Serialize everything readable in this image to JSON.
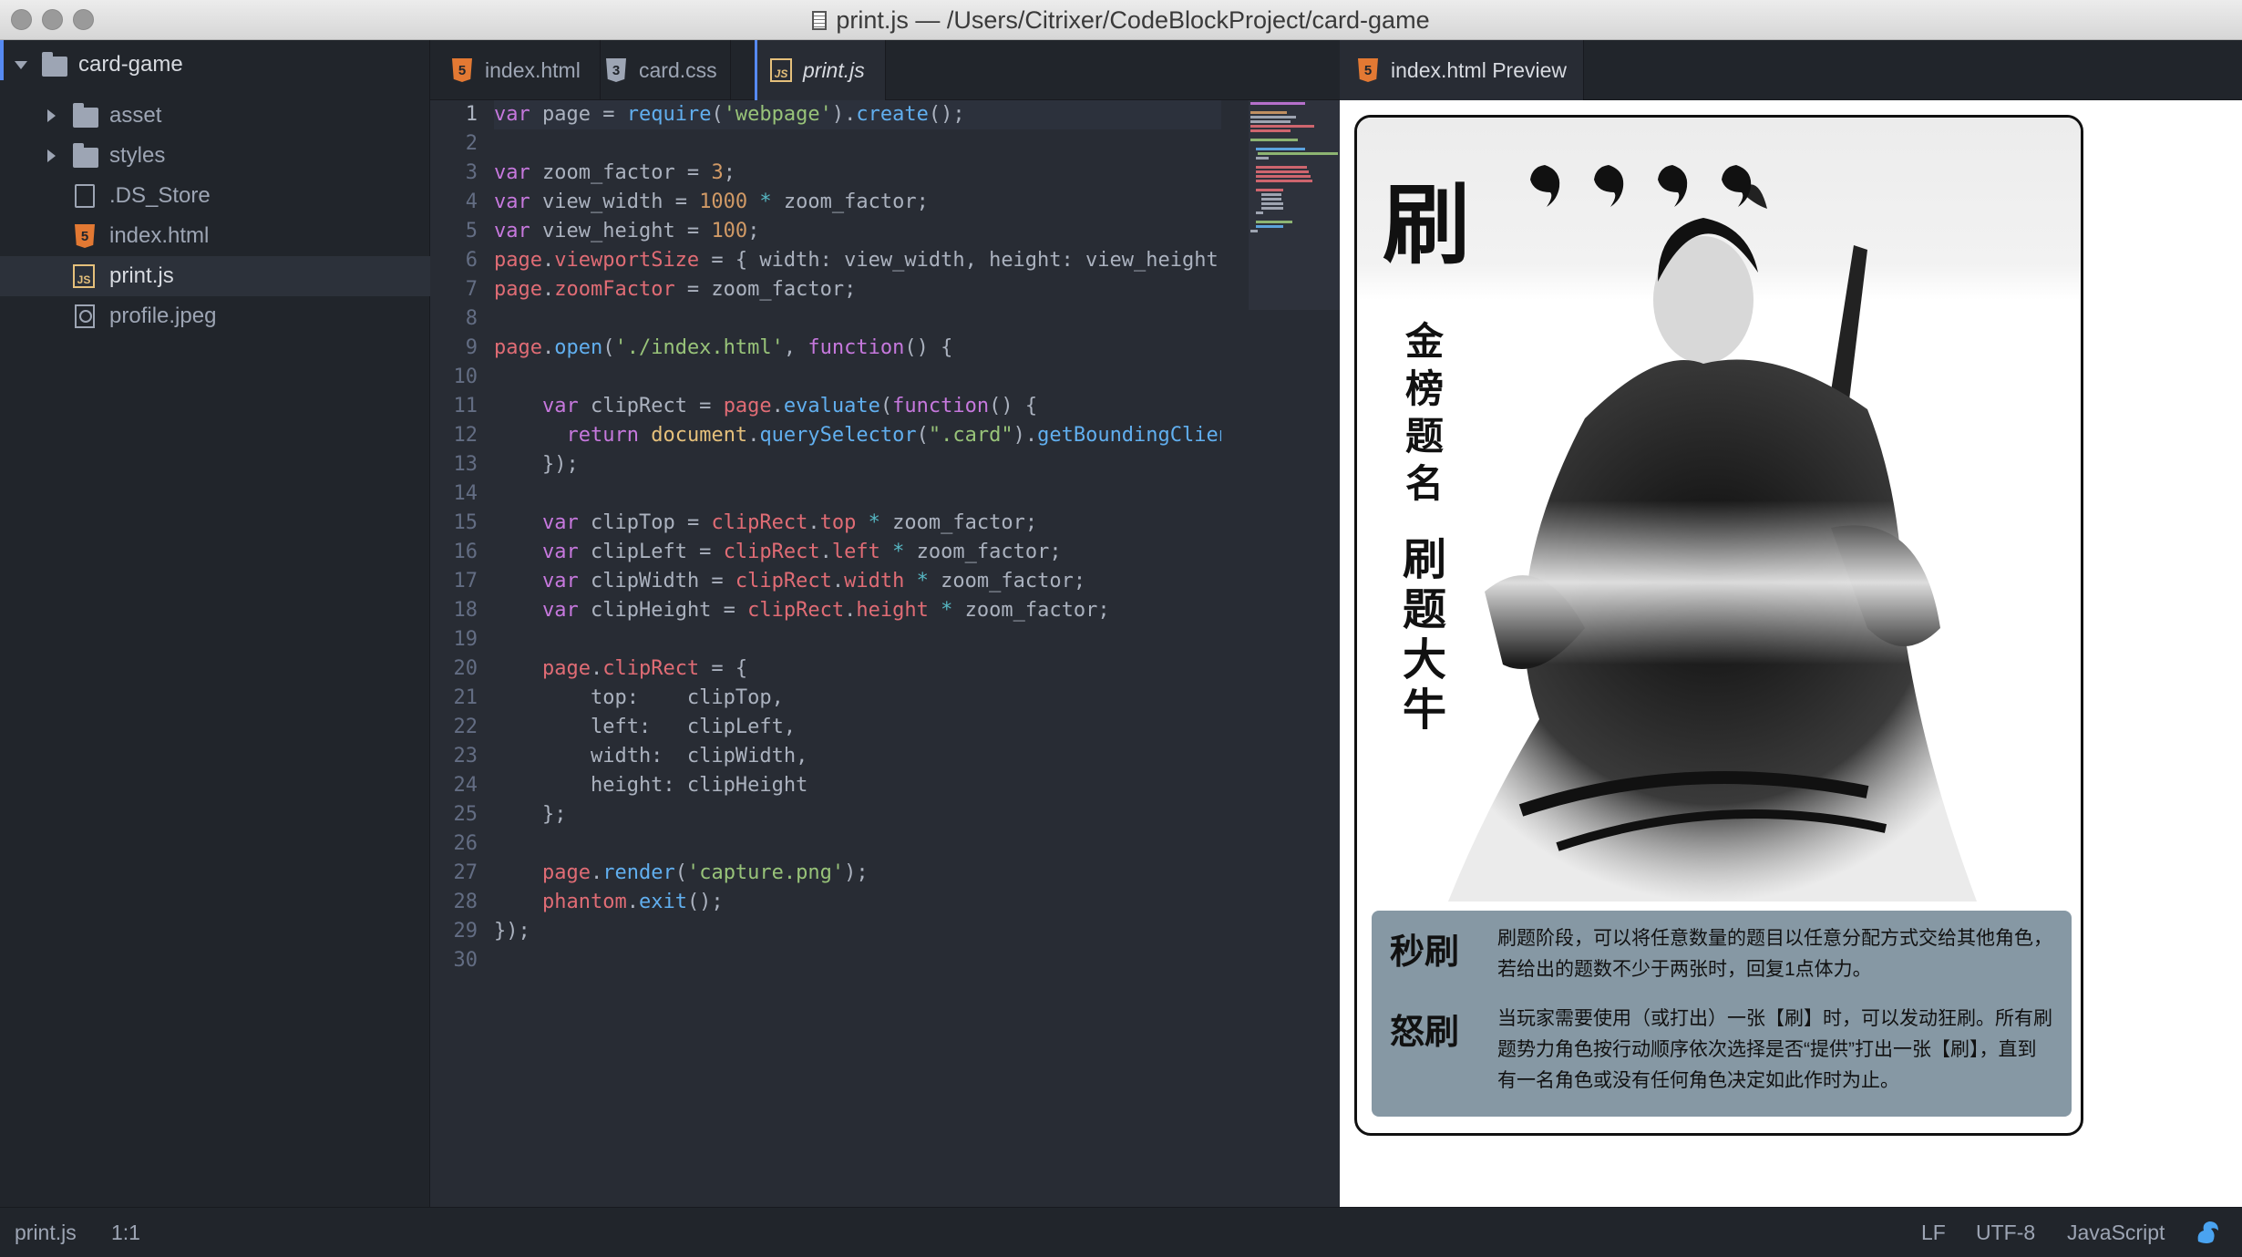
{
  "window": {
    "title": "print.js — /Users/Citrixer/CodeBlockProject/card-game"
  },
  "sidebar": {
    "root": "card-game",
    "items": [
      {
        "label": "asset",
        "type": "folder"
      },
      {
        "label": "styles",
        "type": "folder"
      },
      {
        "label": ".DS_Store",
        "type": "file"
      },
      {
        "label": "index.html",
        "type": "html"
      },
      {
        "label": "print.js",
        "type": "js"
      },
      {
        "label": "profile.jpeg",
        "type": "image"
      }
    ]
  },
  "editor": {
    "tabs": [
      {
        "label": "index.html",
        "icon": "html5-icon"
      },
      {
        "label": "card.css",
        "icon": "css3-icon"
      },
      {
        "label": "print.js",
        "icon": "js-file-icon"
      }
    ],
    "line_numbers": [
      "1",
      "2",
      "3",
      "4",
      "5",
      "6",
      "7",
      "8",
      "9",
      "10",
      "11",
      "12",
      "13",
      "14",
      "15",
      "16",
      "17",
      "18",
      "19",
      "20",
      "21",
      "22",
      "23",
      "24",
      "25",
      "26",
      "27",
      "28",
      "29",
      "30"
    ]
  },
  "preview": {
    "tab_label": "index.html Preview",
    "card": {
      "big_char": "刷",
      "vertical_text": [
        "金",
        "榜",
        "题",
        "名",
        "刷",
        "题",
        "大",
        "牛"
      ],
      "skills": [
        {
          "name": "秒刷",
          "desc": "刷题阶段，可以将任意数量的题目以任意分配方式交给其他角色，若给出的题数不少于两张时，回复1点体力。"
        },
        {
          "name": "怒刷",
          "desc": "当玩家需要使用（或打出）一张【刷】时，可以发动狂刷。所有刷题势力角色按行动顺序依次选择是否“提供”打出一张【刷】，直到有一名角色或没有任何角色决定如此作时为止。"
        }
      ]
    }
  },
  "statusbar": {
    "file": "print.js",
    "cursor": "1:1",
    "line_ending": "LF",
    "encoding": "UTF-8",
    "grammar": "JavaScript"
  },
  "colors": {
    "accent": "#568af2",
    "keyword": "#c678dd",
    "string": "#98c379",
    "function": "#61afef",
    "variable": "#e06c75",
    "number": "#d19a66",
    "operator": "#56b6c2"
  }
}
